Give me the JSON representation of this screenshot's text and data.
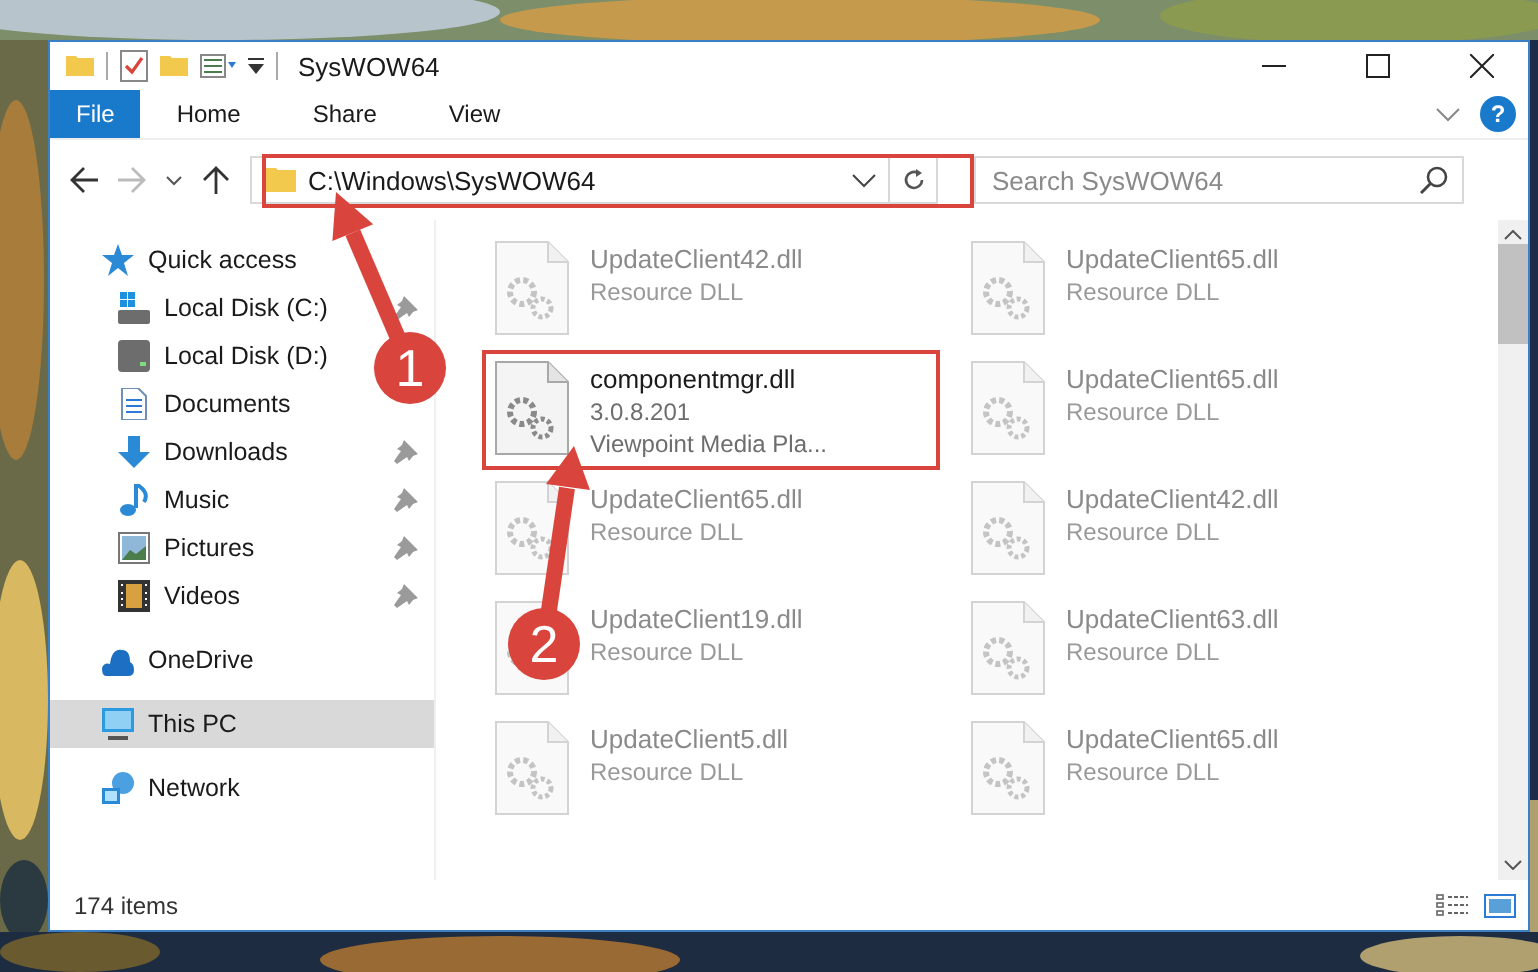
{
  "window": {
    "title": "SysWOW64"
  },
  "ribbon_tabs": [
    {
      "label": "File",
      "kind": "file",
      "selected": false
    },
    {
      "label": "Home",
      "kind": "tab",
      "selected": false
    },
    {
      "label": "Share",
      "kind": "tab",
      "selected": false
    },
    {
      "label": "View",
      "kind": "tab",
      "selected": false
    }
  ],
  "help_button": "?",
  "address_bar": {
    "path": "C:\\Windows\\SysWOW64"
  },
  "search": {
    "placeholder": "Search SysWOW64"
  },
  "nav_items": [
    {
      "label": "Quick access",
      "kind": "quick",
      "pinned": false,
      "selected": false,
      "children": [
        {
          "label": "Local Disk (C:)",
          "kind": "disk-c",
          "pinned": true,
          "selected": false
        },
        {
          "label": "Local Disk (D:)",
          "kind": "disk",
          "pinned": false,
          "selected": false
        },
        {
          "label": "Documents",
          "kind": "documents",
          "pinned": false,
          "selected": false
        },
        {
          "label": "Downloads",
          "kind": "downloads",
          "pinned": true,
          "selected": false
        },
        {
          "label": "Music",
          "kind": "music",
          "pinned": true,
          "selected": false
        },
        {
          "label": "Pictures",
          "kind": "pictures",
          "pinned": true,
          "selected": false
        },
        {
          "label": "Videos",
          "kind": "videos",
          "pinned": true,
          "selected": false
        }
      ]
    },
    {
      "label": "OneDrive",
      "kind": "onedrive",
      "pinned": false,
      "selected": false
    },
    {
      "label": "This PC",
      "kind": "pc",
      "pinned": false,
      "selected": true
    },
    {
      "label": "Network",
      "kind": "network",
      "pinned": false,
      "selected": false
    }
  ],
  "files": [
    {
      "name": "UpdateClient42.dll",
      "details": [
        "Resource DLL"
      ],
      "dimmed": true
    },
    {
      "name": "UpdateClient65.dll",
      "details": [
        "Resource DLL"
      ],
      "dimmed": true
    },
    {
      "name": "componentmgr.dll",
      "details": [
        "3.0.8.201",
        "Viewpoint Media Pla..."
      ],
      "dimmed": false
    },
    {
      "name": "UpdateClient65.dll",
      "details": [
        "Resource DLL"
      ],
      "dimmed": true
    },
    {
      "name": "UpdateClient65.dll",
      "details": [
        "Resource DLL"
      ],
      "dimmed": true
    },
    {
      "name": "UpdateClient42.dll",
      "details": [
        "Resource DLL"
      ],
      "dimmed": true
    },
    {
      "name": "UpdateClient19.dll",
      "details": [
        "Resource DLL"
      ],
      "dimmed": true
    },
    {
      "name": "UpdateClient63.dll",
      "details": [
        "Resource DLL"
      ],
      "dimmed": true
    },
    {
      "name": "UpdateClient5.dll",
      "details": [
        "Resource DLL"
      ],
      "dimmed": true
    },
    {
      "name": "UpdateClient65.dll",
      "details": [
        "Resource DLL"
      ],
      "dimmed": true
    }
  ],
  "status_bar": {
    "item_count": "174 items"
  },
  "annotations": [
    {
      "number": "1"
    },
    {
      "number": "2"
    }
  ]
}
